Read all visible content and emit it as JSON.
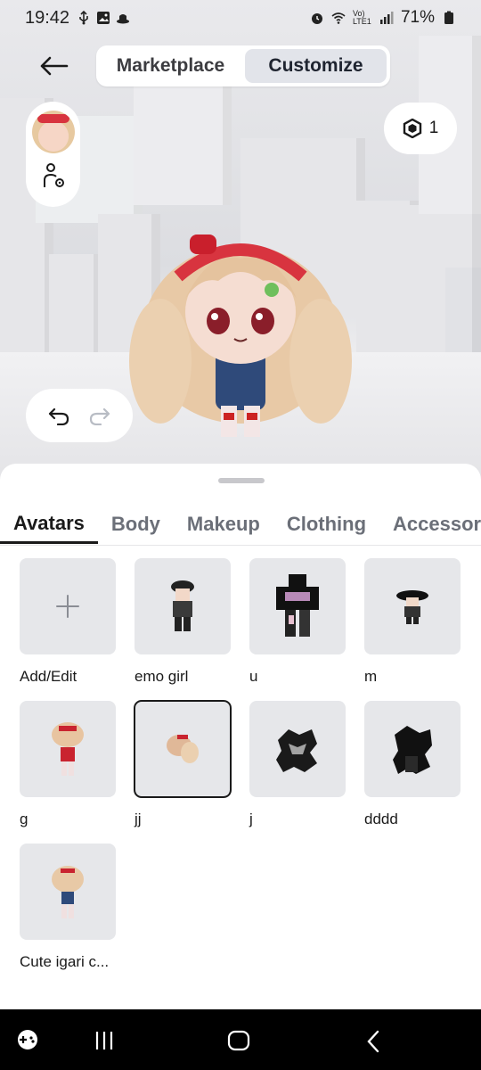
{
  "status": {
    "time": "19:42",
    "battery": "71%",
    "left_icons": [
      "usb-icon",
      "image-icon",
      "hat-icon"
    ],
    "right_icons": [
      "alarm-icon",
      "wifi-icon",
      "volte-icon",
      "signal-icon",
      "battery-icon"
    ],
    "volte_label": "Vo) LTE1"
  },
  "header": {
    "back_icon": "arrow-left-icon",
    "tabs": [
      {
        "label": "Marketplace",
        "active": false
      },
      {
        "label": "Customize",
        "active": true
      }
    ]
  },
  "robux": {
    "icon": "robux-icon",
    "count": "1"
  },
  "sheet": {
    "tabs": [
      "Avatars",
      "Body",
      "Makeup",
      "Clothing",
      "Accessories"
    ],
    "active_tab": "Avatars",
    "items": [
      {
        "label": "Add/Edit",
        "type": "add"
      },
      {
        "label": "emo girl"
      },
      {
        "label": "u"
      },
      {
        "label": "m"
      },
      {
        "label": "g"
      },
      {
        "label": "jj",
        "selected": true
      },
      {
        "label": "j"
      },
      {
        "label": "dddd"
      },
      {
        "label": "Cute igari c..."
      }
    ]
  },
  "colors": {
    "accent_dark": "#1a1a1a",
    "segment_active": "#e2e4ea",
    "thumb_bg": "#e6e7ea"
  }
}
